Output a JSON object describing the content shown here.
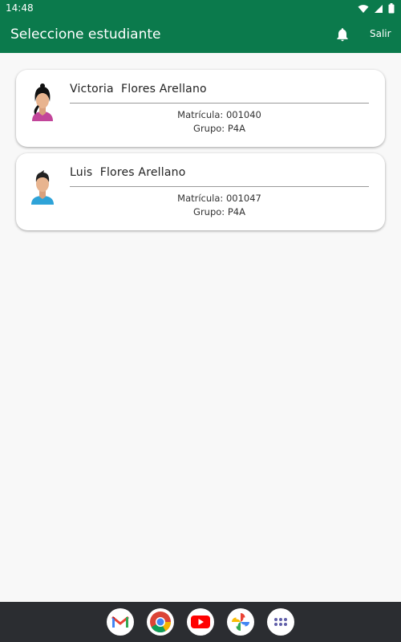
{
  "status_bar": {
    "time": "14:48"
  },
  "app_bar": {
    "title": "Seleccione estudiante",
    "logout_label": "Salir"
  },
  "students": [
    {
      "name": "Victoria  Flores Arellano",
      "matricula": "Matrícula: 001040",
      "grupo": "Grupo: P4A",
      "avatar": "female-avatar-icon"
    },
    {
      "name": "Luis  Flores Arellano",
      "matricula": "Matrícula: 001047",
      "grupo": "Grupo: P4A",
      "avatar": "male-avatar-icon"
    }
  ],
  "dock": [
    "gmail-icon",
    "chrome-icon",
    "youtube-icon",
    "photos-icon",
    "app-drawer-icon"
  ],
  "colors": {
    "primary": "#0b7a4c",
    "background": "#f8f8f8",
    "card": "#ffffff",
    "nav": "#2b2d31"
  }
}
